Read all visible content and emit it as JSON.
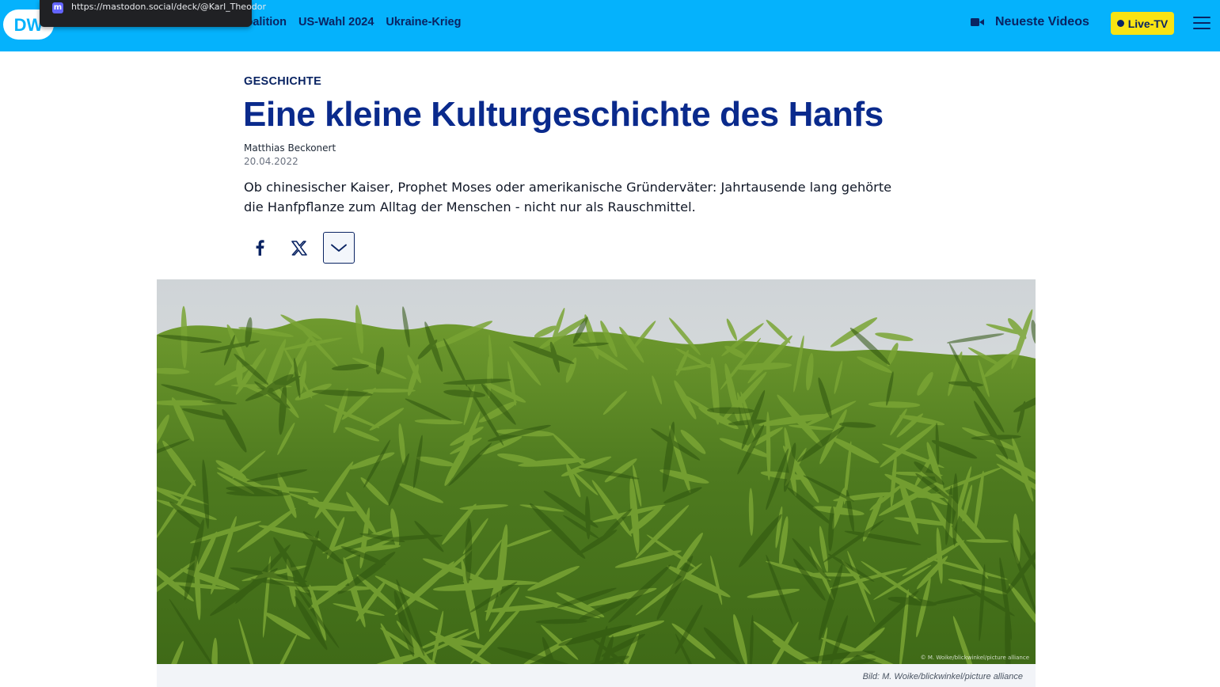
{
  "header": {
    "nav_items": [
      {
        "label": "Ampel-Koalition"
      },
      {
        "label": "US-Wahl 2024"
      },
      {
        "label": "Ukraine-Krieg"
      }
    ],
    "nav_first_visible": "Koalition",
    "videos_label": "Neueste Videos",
    "live_label": "Live-TV",
    "brand_color": "#05b2fc",
    "accent_color": "#0a2463",
    "live_color": "#f9e313",
    "logo": "dw-logo",
    "videos_icon": "video-camera-icon",
    "menu_icon": "hamburger-menu-icon"
  },
  "url_tooltip": {
    "url": "https://mastodon.social/deck/@Karl_Theodor",
    "icon": "mastodon-icon"
  },
  "article": {
    "kicker": "GESCHICHTE",
    "title": "Eine kleine Kulturgeschichte des Hanfs",
    "author": "Matthias Beckonert",
    "date": "20.04.2022",
    "lead_line1": "Ob chinesischer Kaiser, Prophet Moses oder amerikanische Gründerväter: Jahrtausende lang gehörte",
    "lead_line2": "die Hanfpflanze zum Alltag der Menschen - nicht nur als Rauschmittel.",
    "share": [
      {
        "icon": "facebook-icon"
      },
      {
        "icon": "x-twitter-icon"
      },
      {
        "icon": "chevron-down-icon"
      }
    ],
    "image": {
      "overlay_credit": "© M. Woike/blickwinkel/picture alliance",
      "caption": "Bild: M. Woike/blickwinkel/picture alliance"
    }
  }
}
